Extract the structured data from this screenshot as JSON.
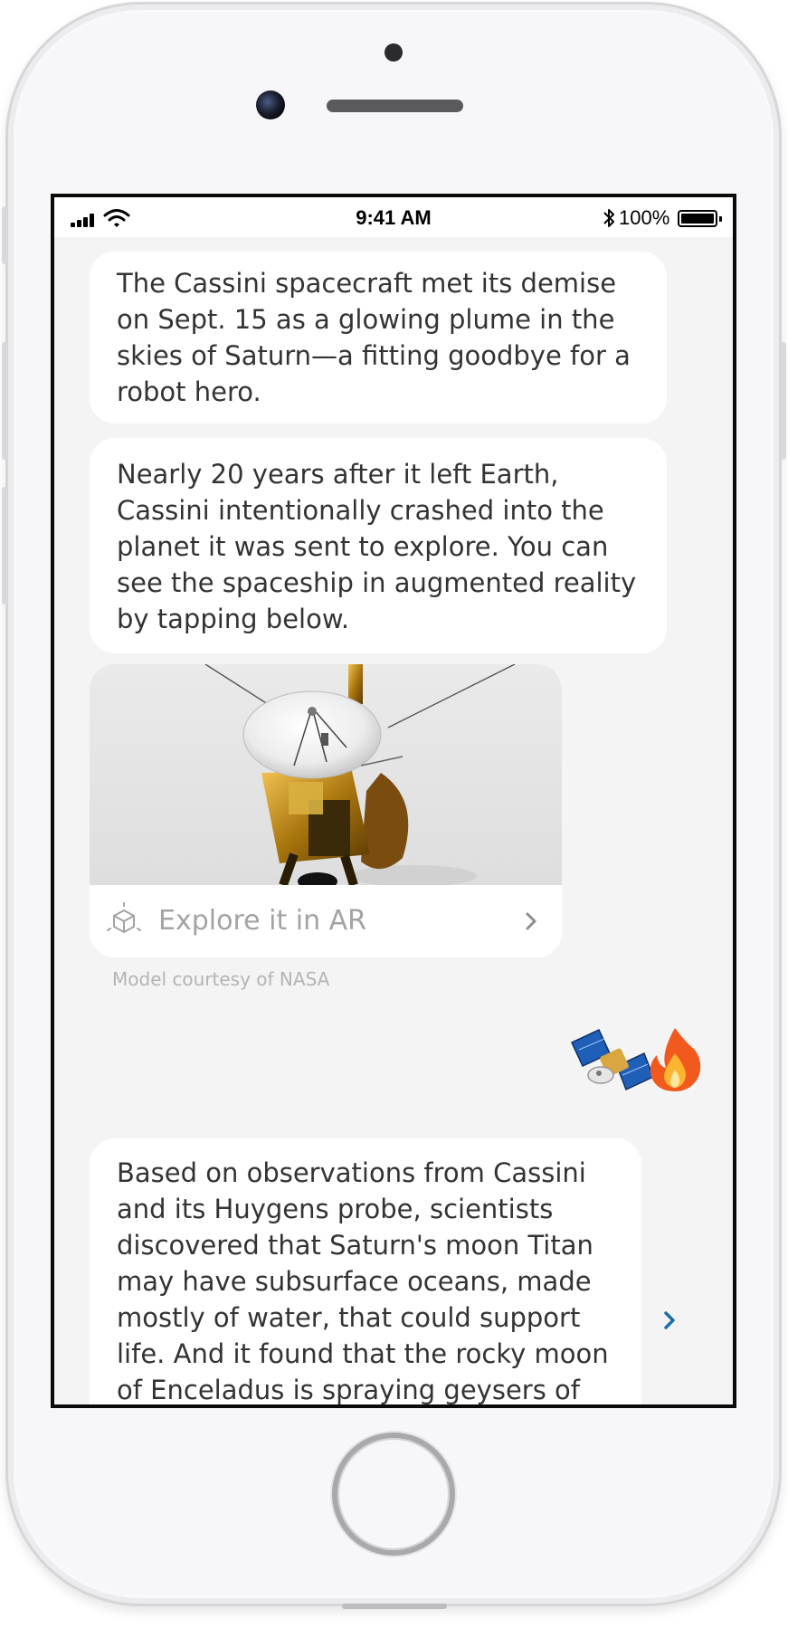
{
  "status_bar": {
    "time": "9:41 AM",
    "battery": "100%",
    "battery_level": 1.0
  },
  "messages": [
    {
      "text": "The Cassini spacecraft met its demise on Sept. 15 as a glowing plume in the skies of Saturn—a fitting goodbye for a robot hero."
    },
    {
      "text": "Nearly 20 years after it left Earth, Cassini intentionally crashed into the planet it was sent to explore. You can see the spaceship in augmented reality by tapping below."
    },
    {
      "text": "Based on observations from Cassini and its Huygens probe, scientists discovered that Saturn's moon Titan may have subsurface oceans, made mostly of water, that could support life. And it found that the rocky moon of Enceladus is spraying geysers of"
    }
  ],
  "ar_card": {
    "label": "Explore it in AR",
    "caption": "Model courtesy of NASA",
    "image": "cassini-spacecraft-model"
  },
  "reactions": [
    "satellite-emoji",
    "fire-emoji"
  ],
  "icons": {
    "ar": "ar-cube-icon",
    "chevron": "chevron-right-icon",
    "signal": "cellular-signal-icon",
    "wifi": "wifi-icon",
    "bluetooth": "bluetooth-icon",
    "battery": "battery-icon"
  },
  "colors": {
    "screen_bg": "#f4f4f4",
    "bubble_bg": "#ffffff",
    "text": "#333333",
    "muted": "#a3a3a3",
    "accent": "#1c6fa8"
  }
}
